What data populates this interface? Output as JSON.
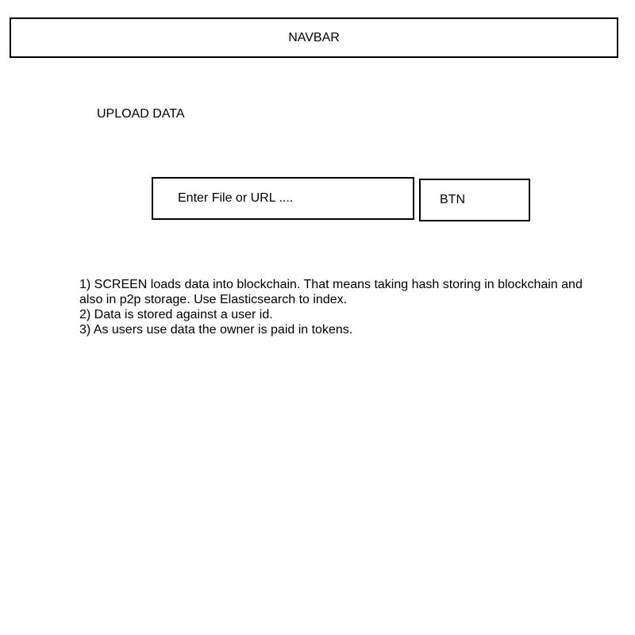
{
  "navbar": {
    "label": "NAVBAR"
  },
  "main": {
    "title": "UPLOAD DATA",
    "input": {
      "placeholder": "Enter File or URL ...."
    },
    "button": {
      "label": "BTN"
    },
    "notes": [
      {
        "text": "1) SCREEN loads data into blockchain. That means taking hash storing in blockchain and also in p2p storage. Use Elasticsearch to index."
      },
      {
        "text": "2) Data is stored against a user id."
      },
      {
        "text": "3) As users use data the owner is paid in tokens."
      }
    ]
  }
}
